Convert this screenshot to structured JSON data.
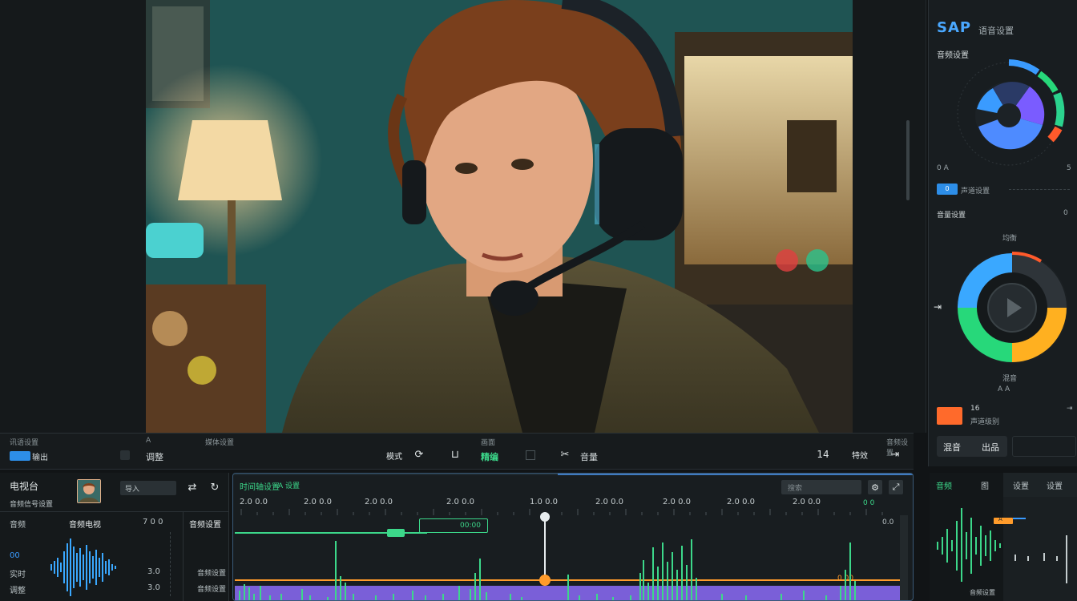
{
  "viewer": {
    "subject": "video-frame"
  },
  "transport": {
    "left_label_1": "讯语设置",
    "left_label_2": "A",
    "left_label_3": "媒体设置",
    "badge_label": "输出",
    "item_label": "调整",
    "mode_label": "模式",
    "center_label": "精编",
    "right_label": "音量",
    "right_small": "音频设置",
    "mid_small": "画面",
    "clock_label": "14",
    "effect_label": "特效",
    "link_label": "链接"
  },
  "right_panel": {
    "title": "SAP",
    "title_sub": "语音设置",
    "section_1": "音频设置",
    "readout_1": "0 A",
    "readout_2": "5",
    "tag_label": "0",
    "tag_text": "声道设置",
    "section_2": "音量设置",
    "section_2_value": "0",
    "caption_top": "均衡",
    "caption_bottom": "混音",
    "caption_bottom_2": "A A",
    "level_label": "16",
    "level_text": "声道级别",
    "btn_left_1": "混音",
    "btn_left_2": "出品",
    "accent": "#ff6a2b",
    "ring_colors": [
      "#3a9bff",
      "#ffb020",
      "#27d87a",
      "#7a5cff",
      "#ff5a2b"
    ]
  },
  "left_bottom": {
    "title": "电视台",
    "sub": "音频信号设置",
    "input_label": "导入",
    "col_a": "音频",
    "col_b": "音频电视",
    "col_c": "7 0 0",
    "col_d": "音频设置",
    "row_1": "00",
    "row_2": "实时",
    "row_3": "调整",
    "val_1": "3.0",
    "val_2": "3.0",
    "val_3": "音频设置",
    "val_4": "音频设置"
  },
  "timeline": {
    "title": "时间轴设置",
    "title_sub": "A 设置",
    "search_placeholder": "搜索",
    "ticks": [
      "2.0 0.0",
      "2.0 0.0",
      "2.0 0.0",
      "2.0 0.0",
      "1.0 0.0",
      "2.0 0.0",
      "2.0 0.0",
      "2.0 0.0",
      "2.0 0.0"
    ],
    "clip_label": "00:00",
    "right_marker": "0 0",
    "marker_label": "0.00",
    "playhead_color": "#ff9b2b"
  },
  "right_bottom": {
    "tab_1": "音频",
    "tab_2": "图",
    "tab_3": "设置",
    "tab_4": "设置",
    "level_tag": "A",
    "footer": "音频设置"
  }
}
